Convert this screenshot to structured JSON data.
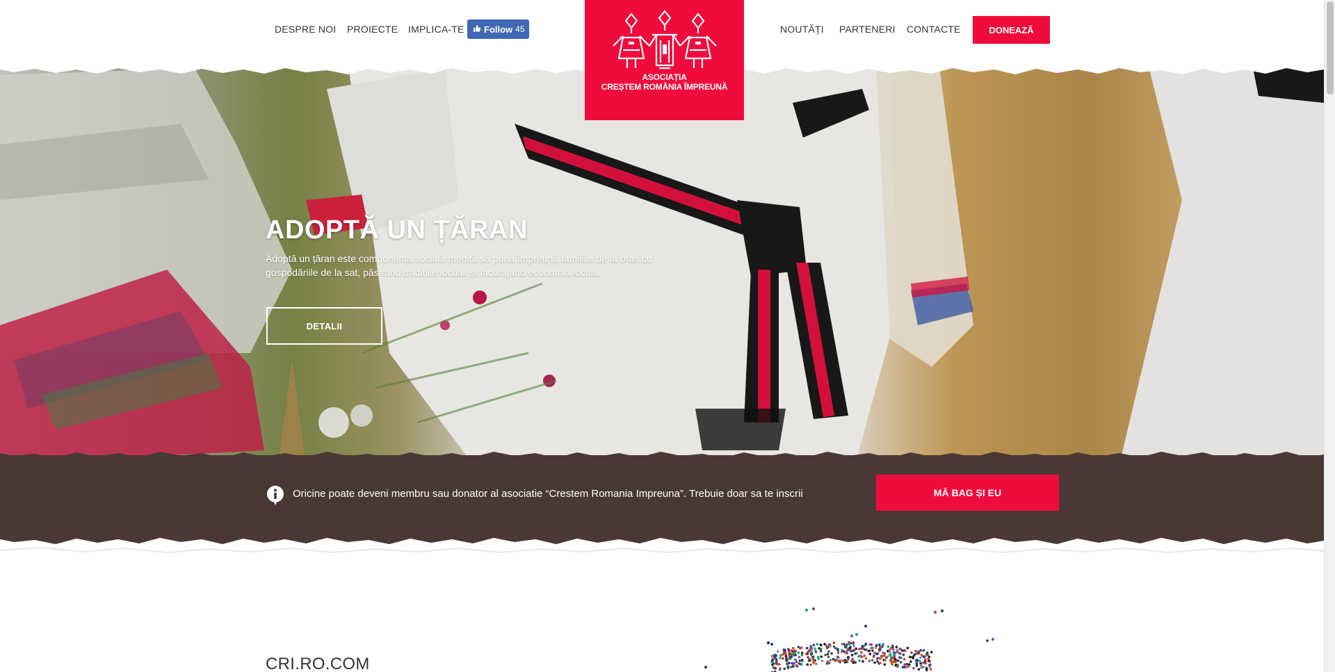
{
  "header": {
    "nav_left": [
      "DESPRE NOI",
      "PROIECTE",
      "IMPLICA-TE"
    ],
    "nav_right": [
      "NOUTĂȚI",
      "PARTENERI",
      "CONTACTE"
    ],
    "fb_follow": {
      "label": "Follow",
      "count": "45"
    },
    "donate_label": "DONEAZĂ"
  },
  "logo": {
    "line1": "ASOCIAȚIA",
    "line2": "CREȘTEM ROMÂNIA ÎMPREUNĂ"
  },
  "hero": {
    "title": "ADOPTĂ UN ȚĂRAN",
    "description": "Adoptă un țăran este componenta socială menită să pună împreună familiile de la oraș cu gospodăriile de la sat, păstrând tradițiile locului și încurajând economia locală.",
    "button_label": "DETALII"
  },
  "info_bar": {
    "text": "Oricine poate deveni membru sau donator al asociatie “Crestem Romania Impreuna”. Trebuie doar sa te inscrii",
    "button_label": "MĂ BAG ȘI EU"
  },
  "section": {
    "heading": "CRI.RO.COM"
  },
  "colors": {
    "brand_red": "#ef0c3c",
    "info_bar_brown": "#4a3835",
    "facebook_blue": "#4267b2"
  }
}
